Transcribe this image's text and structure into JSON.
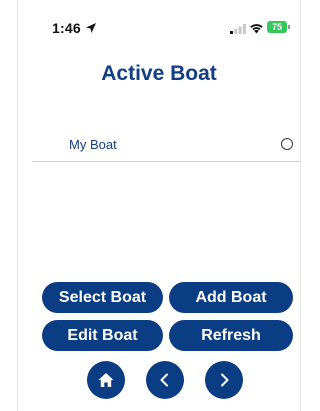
{
  "status_bar": {
    "time": "1:46",
    "battery": "75",
    "battery_color": "#34c759"
  },
  "page": {
    "title": "Active Boat"
  },
  "boats": [
    {
      "name": "My Boat",
      "selected": false
    }
  ],
  "buttons": {
    "select_boat": "Select Boat",
    "add_boat": "Add Boat",
    "edit_boat": "Edit Boat",
    "refresh": "Refresh"
  },
  "nav": {
    "home_icon": "home-icon",
    "back_icon": "chevron-left-icon",
    "forward_icon": "chevron-right-icon"
  },
  "colors": {
    "primary": "#0a3d84",
    "title": "#123e84"
  }
}
